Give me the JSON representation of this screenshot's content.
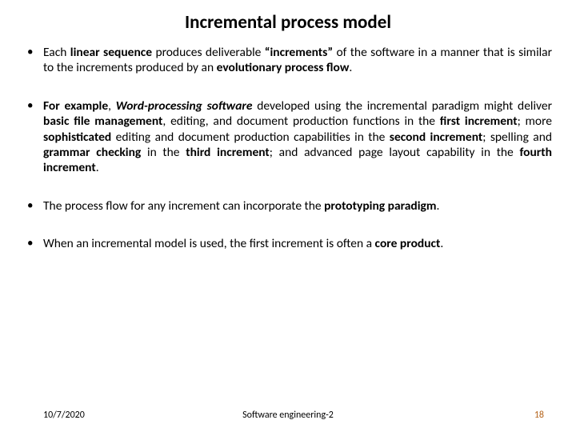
{
  "title": "Incremental process model",
  "bullets": {
    "b1": {
      "t1": "Each ",
      "s1": "linear sequence",
      "t2": " produces deliverable ",
      "s2": "“increments”",
      "t3": " of the software in a manner that is similar to the increments produced by an ",
      "s3": "evolutionary process flow",
      "t4": "."
    },
    "b2": {
      "s1": "For example",
      "t1": ", ",
      "s2": "Word-processing software",
      "t2": " developed using the incremental paradigm might deliver ",
      "s3": "basic file management",
      "t3": ", editing, and document production functions in the ",
      "s4": "first increment",
      "t4": "; more ",
      "s5": "sophisticated",
      "t5": " editing and document production capabilities in the ",
      "s6": "second increment",
      "t6": "; spelling and ",
      "s7": "grammar checking",
      "t7": " in the ",
      "s8": "third increment",
      "t8": "; and advanced page layout capability in the ",
      "s9": "fourth increment",
      "t9": "."
    },
    "b3": {
      "t1": "The process flow for any increment can incorporate the ",
      "s1": "prototyping paradigm",
      "t2": "."
    },
    "b4": {
      "t1": "When an incremental model is used, the first increment is often a ",
      "s1": "core product",
      "t2": "."
    }
  },
  "footer": {
    "date": "10/7/2020",
    "course": "Software engineering-2",
    "page": "18"
  }
}
